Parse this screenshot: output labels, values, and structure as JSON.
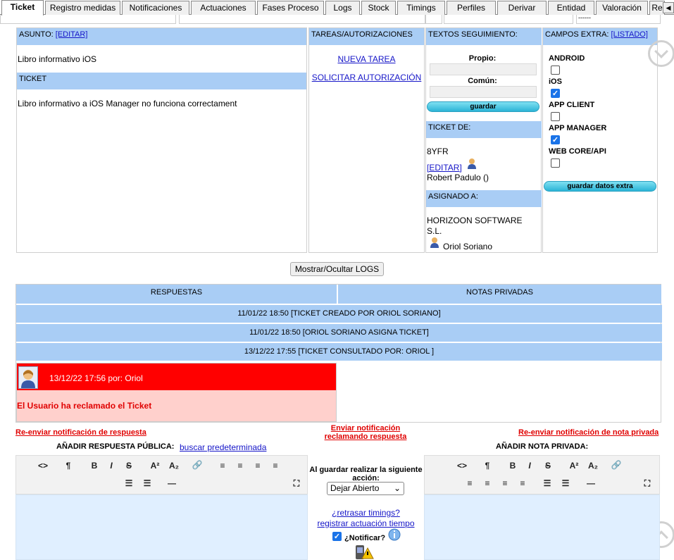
{
  "tabs": [
    "Ticket",
    "Registro medidas",
    "Notificaciones",
    "Actuaciones",
    "Fases Proceso",
    "Logs",
    "Stock",
    "Timings",
    "Perfiles",
    "Derivar",
    "Entidad",
    "Valoración",
    "Re"
  ],
  "top_dashes": "------",
  "asunto": {
    "header": "ASUNTO:",
    "edit": "[EDITAR]",
    "text": "Libro informativo iOS"
  },
  "ticket": {
    "header": "TICKET",
    "text": "Libro informativo a  iOS Manager no funciona correctament"
  },
  "tareas": {
    "header": "TAREAS/AUTORIZACIONES",
    "nueva": "NUEVA TAREA",
    "solicitar": "SOLICITAR AUTORIZACIÓN"
  },
  "textos": {
    "header": "TEXTOS SEGUIMIENTO:",
    "propio": "Propio:",
    "comun": "Común:",
    "guardar": "guardar"
  },
  "ticket_de": {
    "header": "TICKET DE:",
    "code": "8YFR",
    "edit": "[EDITAR]",
    "name": "Robert Padulo ()"
  },
  "asignado": {
    "header": "ASIGNADO A:",
    "company": "HORIZOON SOFTWARE S.L.",
    "name": "Oriol Soriano"
  },
  "campos": {
    "header": "CAMPOS EXTRA:",
    "listado": "[LISTADO]",
    "items": [
      {
        "label": "ANDROID",
        "checked": false
      },
      {
        "label": "iOS",
        "checked": true
      },
      {
        "label": "APP CLIENT",
        "checked": false
      },
      {
        "label": "APP MANAGER",
        "checked": true
      },
      {
        "label": "WEB CORE/API",
        "checked": false
      }
    ],
    "save": "guardar datos extra"
  },
  "logs_button": "Mostrar/Ocultar LOGS",
  "respuestas": "RESPUESTAS",
  "notas": "NOTAS PRIVADAS",
  "log_rows": [
    "11/01/22 18:50  [TICKET CREADO POR ORIOL SORIANO]",
    "11/01/22 18:50  [ORIOL SORIANO ASIGNA TICKET]",
    "13/12/22 17:55  [TICKET CONSULTADO POR: ORIOL ]"
  ],
  "reclamo": {
    "title": "13/12/22 17:56 por:  Oriol",
    "body": "El Usuario ha reclamado el Ticket"
  },
  "links": {
    "reenviar_resp": "Re-enviar notificación de respuesta",
    "enviar_recl_1": "Enviar notificación",
    "enviar_recl_2": "reclamando respuesta",
    "reenviar_nota": "Re-enviar notificación de nota privada"
  },
  "publica": {
    "label": "AÑADIR RESPUESTA PÚBLICA:",
    "buscar": "buscar predeterminada"
  },
  "privada": {
    "label": "AÑADIR NOTA PRIVADA:"
  },
  "accion": {
    "label": "Al guardar realizar la siguiente acción:",
    "selected": "Dejar Abierto",
    "retrasar": "¿retrasar timings?",
    "registrar": "registrar actuación tiempo",
    "notificar": "¿Notificar?",
    "notificar_checked": true
  },
  "colors": {
    "header_blue": "#a9cdf5",
    "red": "#ff0000",
    "pink": "#ffd0cc",
    "editor": "#e0efff"
  }
}
